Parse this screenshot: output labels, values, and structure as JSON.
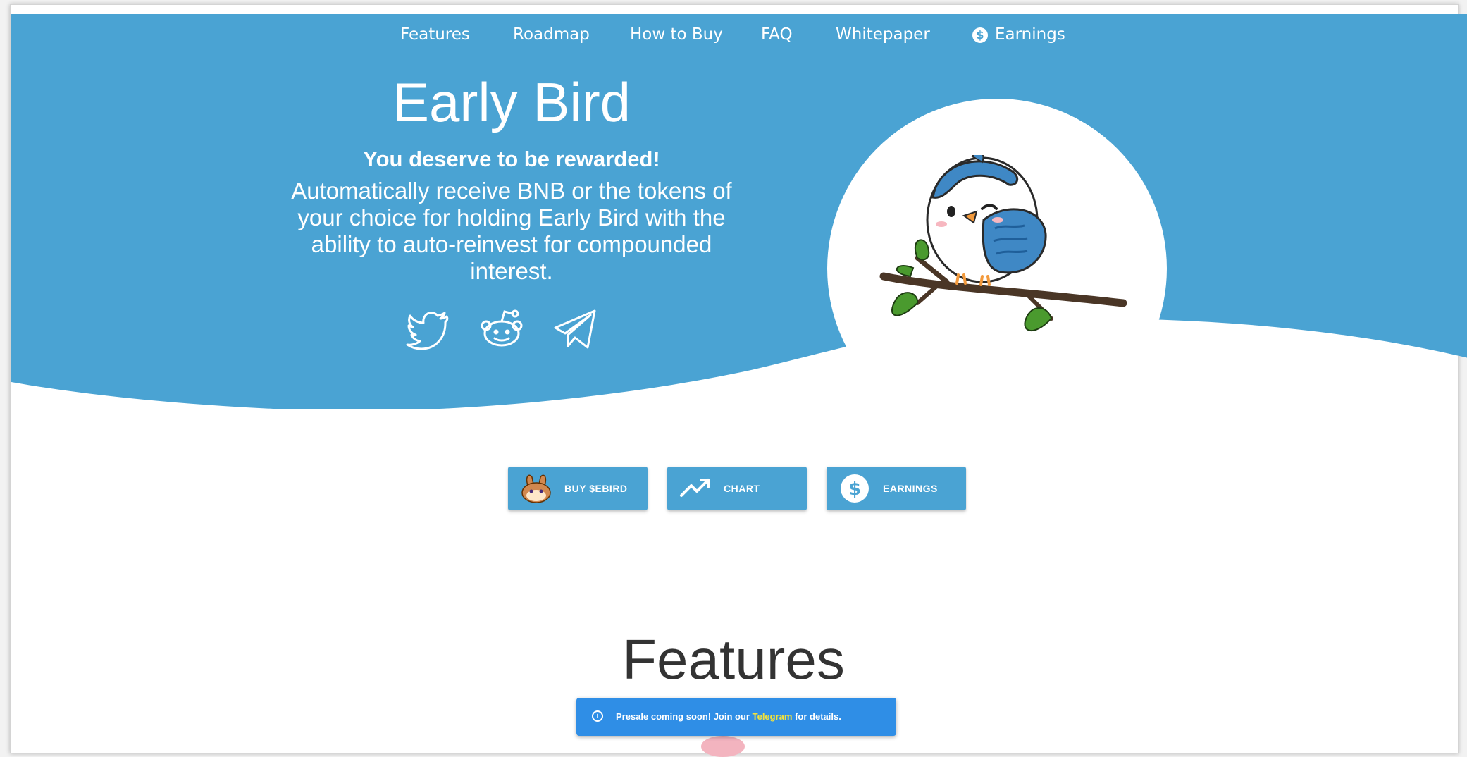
{
  "nav": {
    "items": [
      {
        "label": "Features"
      },
      {
        "label": "Roadmap"
      },
      {
        "label": "How to Buy"
      },
      {
        "label": "FAQ"
      },
      {
        "label": "Whitepaper"
      },
      {
        "label": "Earnings",
        "icon": "dollar-circle-icon"
      }
    ]
  },
  "hero": {
    "title": "Early Bird",
    "subtitle": "You deserve to be rewarded!",
    "description": "Automatically receive BNB or the tokens of your choice for holding Early Bird with the ability to auto-reinvest for compounded interest.",
    "social": [
      {
        "icon": "twitter-icon"
      },
      {
        "icon": "reddit-icon"
      },
      {
        "icon": "telegram-icon"
      }
    ],
    "mascot": "bird-mascot-on-branch"
  },
  "buttons": [
    {
      "label": "BUY $EBIRD",
      "icon": "pancakeswap-bunny-icon"
    },
    {
      "label": "CHART",
      "icon": "trending-up-icon"
    },
    {
      "label": "EARNINGS",
      "icon": "dollar-circle-icon"
    }
  ],
  "features": {
    "heading": "Features"
  },
  "toast": {
    "text_before": "Presale coming soon! Join our",
    "link": "Telegram",
    "text_after": "for details.",
    "icon": "info-icon"
  },
  "colors": {
    "brand_blue": "#4aa3d3",
    "toast_blue": "#2f8ee6",
    "toast_link": "#f4e23a",
    "leaf_green": "#4a9a2e",
    "branch_brown": "#4a3626",
    "beak_orange": "#f39a3c",
    "heading_text": "#333333"
  }
}
